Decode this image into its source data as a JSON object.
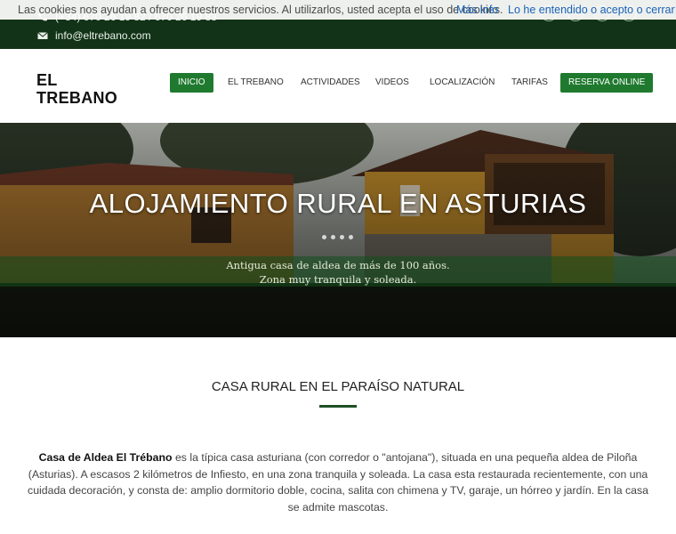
{
  "topbar": {
    "phone": "(+34) 670 26 19 82 / 670 26 19 83",
    "email": "info@eltrebano.com",
    "phone_icon": "phone-icon",
    "email_icon": "envelope-icon"
  },
  "cookie_bar": {
    "message": "Las cookies nos ayudan a ofrecer nuestros servicios. Al utilizarlos, usted acepta el uso de cookies.",
    "more_info": "Más info",
    "accept": "Lo he entendido o acepto o cerrar"
  },
  "brand": {
    "line1": "EL",
    "line2": "TREBANO"
  },
  "nav": {
    "items": [
      "INICIO",
      "EL TREBANO",
      "ACTIVIDADES",
      "VIDEOS",
      "LOCALIZACIÓN",
      "TARIFAS"
    ],
    "cta": "RESERVA ONLINE"
  },
  "hero": {
    "title": "ALOJAMIENTO RURAL EN ASTURIAS",
    "subtitle_line1": "Antigua casa de aldea de más de 100 años.",
    "subtitle_line2": "Zona muy tranquila y soleada."
  },
  "section": {
    "title": "CASA RURAL EN EL PARAÍSO NATURAL",
    "lead": "Casa de Aldea El Trébano",
    "body": " es la típica casa asturiana (con corredor o \"antojana\"), situada en una pequeña aldea de Piloña (Asturias). A escasos 2 kilómetros de Infiesto, en una zona tranquila y soleada. La casa esta restaurada recientemente, con una cuidada decoración, y consta de: amplio dormitorio doble, cocina, salita con chimena y TV, garaje, un hórreo y jardín. En la casa se admite mascotas."
  },
  "colors": {
    "topbar": "#123317",
    "accent": "#1f7a2f",
    "link": "#1a63b7"
  }
}
